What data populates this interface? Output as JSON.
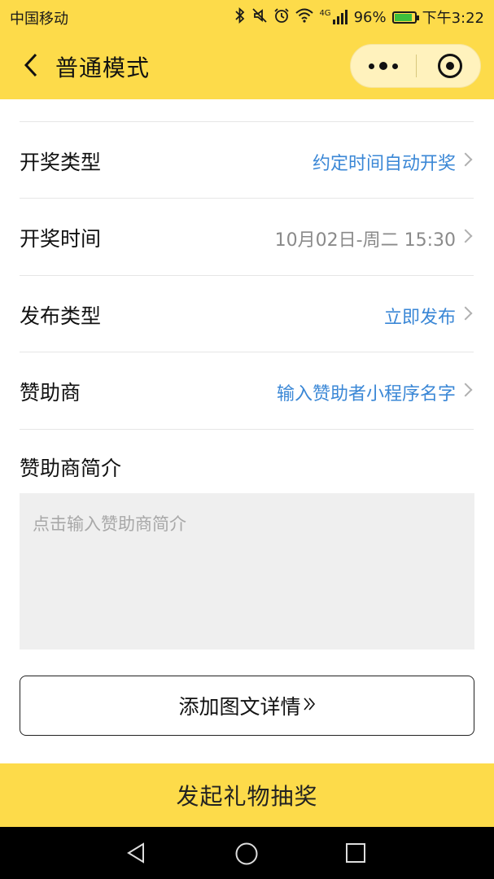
{
  "status_bar": {
    "carrier": "中国移动",
    "network": "4G",
    "battery": "96%",
    "battery_level": 0.96,
    "time": "下午3:22",
    "icons": [
      "bluetooth-icon",
      "mute-icon",
      "alarm-icon",
      "wifi-icon",
      "signal-icon",
      "battery-icon"
    ]
  },
  "navbar": {
    "title": "普通模式",
    "back_icon": "chevron-left-icon",
    "menu_icon": "more-dots-icon",
    "close_icon": "target-close-icon"
  },
  "settings": [
    {
      "label": "开奖类型",
      "value": "约定时间自动开奖",
      "value_color": "#3a87d6"
    },
    {
      "label": "开奖时间",
      "value": "10月02日-周二 15:30",
      "value_color": "#8a8a8a"
    },
    {
      "label": "发布类型",
      "value": "立即发布",
      "value_color": "#3a87d6"
    },
    {
      "label": "赞助商",
      "value": "输入赞助者小程序名字",
      "value_color": "#3a87d6"
    }
  ],
  "sponsor_intro": {
    "label": "赞助商简介",
    "placeholder": "点击输入赞助商简介"
  },
  "detail_button": {
    "label": "添加图文详情",
    "icon": "double-chevron-right-icon"
  },
  "submit_button": {
    "label": "发起礼物抽奖"
  },
  "colors": {
    "accent": "#fddb4a",
    "link": "#3a87d6"
  }
}
